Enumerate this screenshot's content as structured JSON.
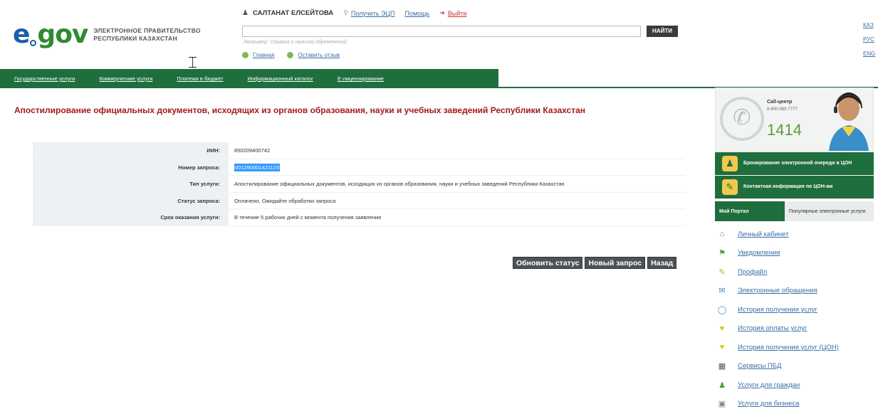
{
  "logo": {
    "mark": "gov",
    "tagline_1": "ЭЛЕКТРОННОЕ ПРАВИТЕЛЬСТВО",
    "tagline_2": "РЕСПУБЛИКИ КАЗАХСТАН"
  },
  "userbar": {
    "user_name": "САЛТАНАТ ЕЛСЕЙТОВА",
    "get_eds": "Получить ЭЦП",
    "help": "Помощь",
    "logout": "Выйти"
  },
  "search": {
    "button": "НАЙТИ",
    "hint": "Например: Справка о наличии обременений"
  },
  "subnav": {
    "home": "Главная",
    "feedback": "Оставить отзыв"
  },
  "langs": [
    "КАЗ",
    "РУС",
    "ENG"
  ],
  "nav": [
    "Государственные услуги",
    "Коммерческие услуги",
    "Платежи в бюджет",
    "Информационный каталог",
    "Е-лицензирование"
  ],
  "page": {
    "title": "Апостилирование официальных документов, исходящих из органов образования, науки и учебных заведений Республики Казахстан"
  },
  "info_rows": [
    {
      "label": "ИИН:",
      "value": "850209400742"
    },
    {
      "label": "Номер запроса:",
      "value": "001290001421123"
    },
    {
      "label": "Тип услуги:",
      "value": "Апостилирование официальных документов, исходящих из органов образования, науки и учебных заведений Республики Казахстан"
    },
    {
      "label": "Статус запроса:",
      "value": "Оплачено. Ожидайте обработки запроса"
    },
    {
      "label": "Срок оказания услуги:",
      "value": "В течение 5 рабочих дней с момента получения заявления"
    }
  ],
  "buttons": {
    "refresh": "Обновить статус",
    "new_request": "Новый запрос",
    "back": "Назад"
  },
  "call_center": {
    "label": "Call-центр",
    "phone": "8-800-080-7777",
    "short_number": "1414"
  },
  "sidebar": {
    "queue_booking": "Бронирование электронной очереди в ЦОН",
    "con_contacts": "Контактная информация по ЦОН-ам",
    "tab_active": "Мой Портал",
    "tab_inactive": "Популярные электронные услуги",
    "menu": [
      {
        "label": "Личный кабинет",
        "icon": "home-icon"
      },
      {
        "label": "Уведомления",
        "icon": "notification-icon"
      },
      {
        "label": "Профайл",
        "icon": "profile-icon"
      },
      {
        "label": "Электронные обращения",
        "icon": "mail-icon"
      },
      {
        "label": "История получения услуг",
        "icon": "history-icon"
      },
      {
        "label": "История оплаты услуг",
        "icon": "payment-history-icon"
      },
      {
        "label": "История получения услуг (ЦОН)",
        "icon": "con-history-icon"
      },
      {
        "label": "Сервисы ПБД",
        "icon": "services-icon"
      },
      {
        "label": "Услуги для граждан",
        "icon": "citizens-icon"
      },
      {
        "label": "Услуги для бизнеса",
        "icon": "business-icon"
      }
    ]
  },
  "colors": {
    "brand_green": "#1f6e3d",
    "title_red": "#a31a1a",
    "link_blue": "#3a6ea5"
  }
}
